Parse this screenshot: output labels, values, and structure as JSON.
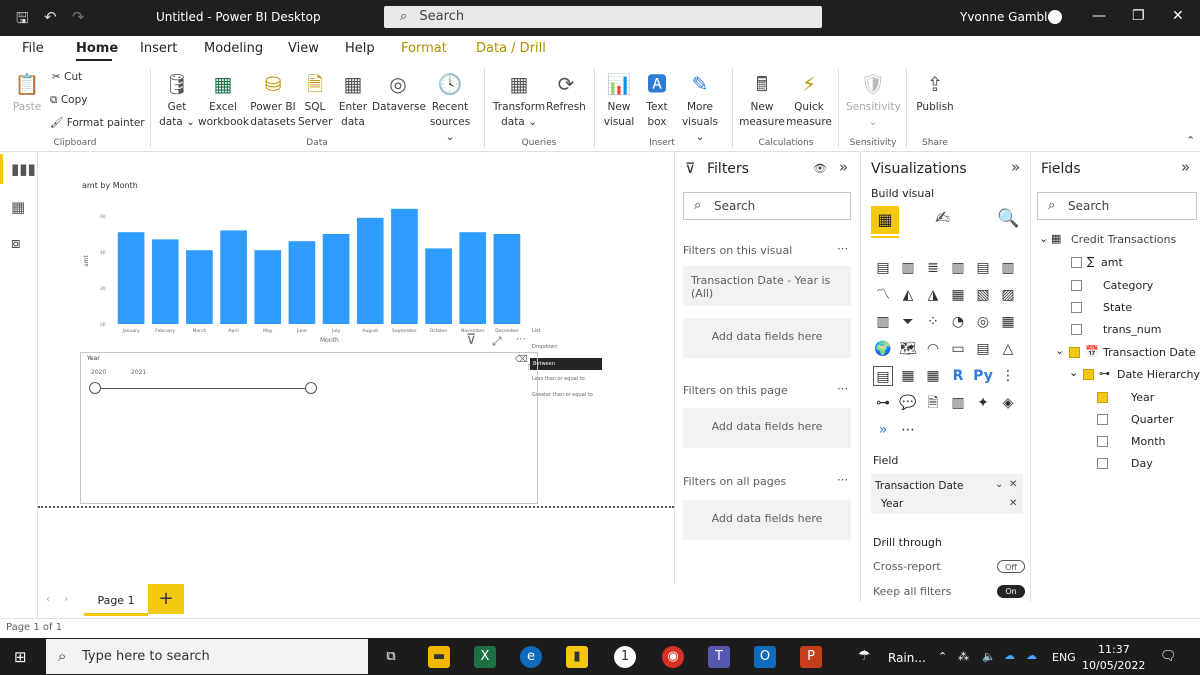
{
  "window": {
    "title": "Untitled - Power BI Desktop",
    "search": "Search",
    "user": "Yvonne Gamble"
  },
  "tabs": [
    "File",
    "Home",
    "Insert",
    "Modeling",
    "View",
    "Help",
    "Format",
    "Data / Drill"
  ],
  "ribbon": {
    "paste": "Paste",
    "cut": "Cut",
    "copy": "Copy",
    "format_painter": "Format painter",
    "get_data_1": "Get",
    "get_data_2": "data ⌄",
    "excel_1": "Excel",
    "excel_2": "workbook",
    "pbi_1": "Power BI",
    "pbi_2": "datasets",
    "sql_1": "SQL",
    "sql_2": "Server",
    "enter_1": "Enter",
    "enter_2": "data",
    "dataverse": "Dataverse",
    "recent_1": "Recent",
    "recent_2": "sources ⌄",
    "transform_1": "Transform",
    "transform_2": "data ⌄",
    "refresh": "Refresh",
    "newvisual_1": "New",
    "newvisual_2": "visual",
    "textbox_1": "Text",
    "textbox_2": "box",
    "more_1": "More",
    "more_2": "visuals ⌄",
    "newmeasure_1": "New",
    "newmeasure_2": "measure",
    "quick_1": "Quick",
    "quick_2": "measure",
    "sensitivity_1": "Sensitivity",
    "sensitivity_2": "⌄",
    "publish": "Publish",
    "groups": {
      "clipboard": "Clipboard",
      "data": "Data",
      "queries": "Queries",
      "insert": "Insert",
      "calculations": "Calculations",
      "sensitivity": "Sensitivity",
      "share": "Share"
    }
  },
  "chart_data": {
    "type": "bar",
    "title": "amt by Month",
    "xlabel": "Month",
    "ylabel": "amt",
    "categories": [
      "January",
      "February",
      "March",
      "April",
      "May",
      "June",
      "July",
      "August",
      "September",
      "October",
      "November",
      "December"
    ],
    "values": [
      5.1,
      4.7,
      4.1,
      5.2,
      4.1,
      4.6,
      5.0,
      5.9,
      6.4,
      4.2,
      5.1,
      5.0
    ],
    "ylim": [
      0,
      7
    ],
    "yticks": [
      "0K",
      "2K",
      "4K",
      "6K"
    ],
    "bar_color": "#2f9bff"
  },
  "slicer": {
    "title": "Year",
    "min_label": "2020",
    "max_label": "2021"
  },
  "slicer_menu": [
    "List",
    "Dropdown",
    "Between",
    "Less than or equal to",
    "Greater than or equal to"
  ],
  "filters": {
    "title": "Filters",
    "search": "Search",
    "on_visual": "Filters on this visual",
    "card_visual": "Transaction Date - Year is (All)",
    "add_fields": "Add data fields here",
    "on_page": "Filters on this page",
    "on_all": "Filters on all pages"
  },
  "viz": {
    "title": "Visualizations",
    "build": "Build visual",
    "field_label": "Field",
    "field_value": "Transaction Date",
    "field_sub": "Year",
    "drill": "Drill through",
    "cross": "Cross-report",
    "cross_state": "Off",
    "keep": "Keep all filters",
    "keep_state": "On",
    "r_icon": "R",
    "py_icon": "Py"
  },
  "fields": {
    "title": "Fields",
    "search": "Search",
    "table": "Credit Transactions",
    "items": [
      "amt",
      "Category",
      "State",
      "trans_num"
    ],
    "date": "Transaction Date",
    "hierarchy": "Date Hierarchy",
    "levels": [
      "Year",
      "Quarter",
      "Month",
      "Day"
    ]
  },
  "pages": {
    "page1": "Page 1",
    "add": "+",
    "status": "Page 1 of 1"
  },
  "taskbar": {
    "search": "Type here to search",
    "weather": "Rain...",
    "lang": "ENG",
    "time": "11:37",
    "date": "10/05/2022"
  }
}
